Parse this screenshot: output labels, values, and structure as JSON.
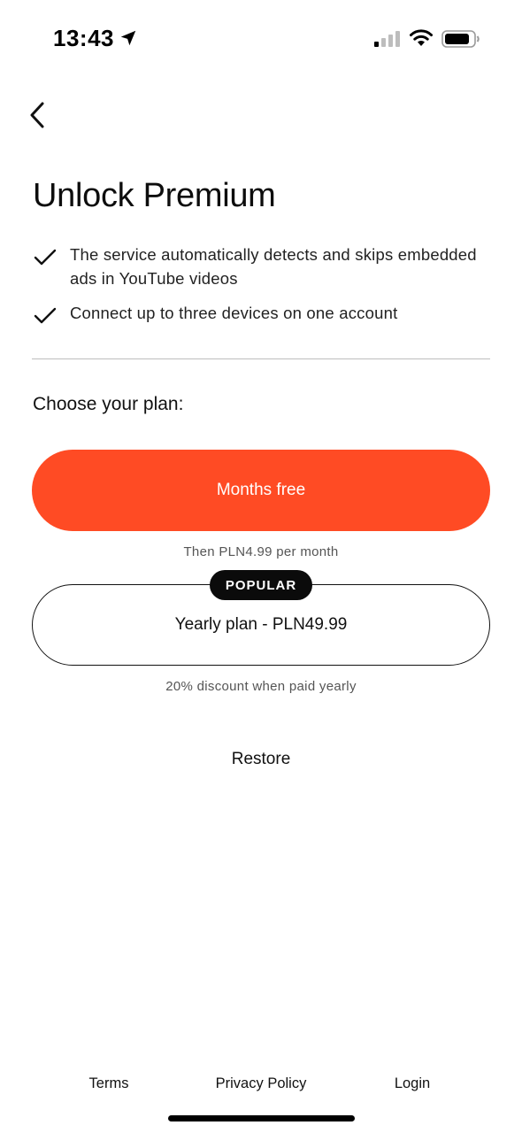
{
  "status_bar": {
    "time": "13:43",
    "icons": [
      "location-arrow-icon",
      "cellular-signal-icon",
      "wifi-icon",
      "battery-icon"
    ]
  },
  "header": {
    "back_icon": "chevron-left-icon"
  },
  "title": "Unlock Premium",
  "features": [
    "The service automatically detects and skips embedded ads in YouTube videos",
    "Connect up to three devices on one account"
  ],
  "plans": {
    "heading": "Choose your plan:",
    "primary": {
      "label": "Months free",
      "note": "Then PLN4.99 per month"
    },
    "yearly": {
      "badge": "POPULAR",
      "label": "Yearly plan - PLN49.99",
      "note": "20% discount when paid yearly"
    }
  },
  "restore_label": "Restore",
  "footer": {
    "terms": "Terms",
    "privacy": "Privacy Policy",
    "login": "Login"
  },
  "colors": {
    "accent": "#ff4b24",
    "text": "#111111",
    "badge_bg": "#0b0b0b",
    "divider": "#bdbdbd"
  }
}
